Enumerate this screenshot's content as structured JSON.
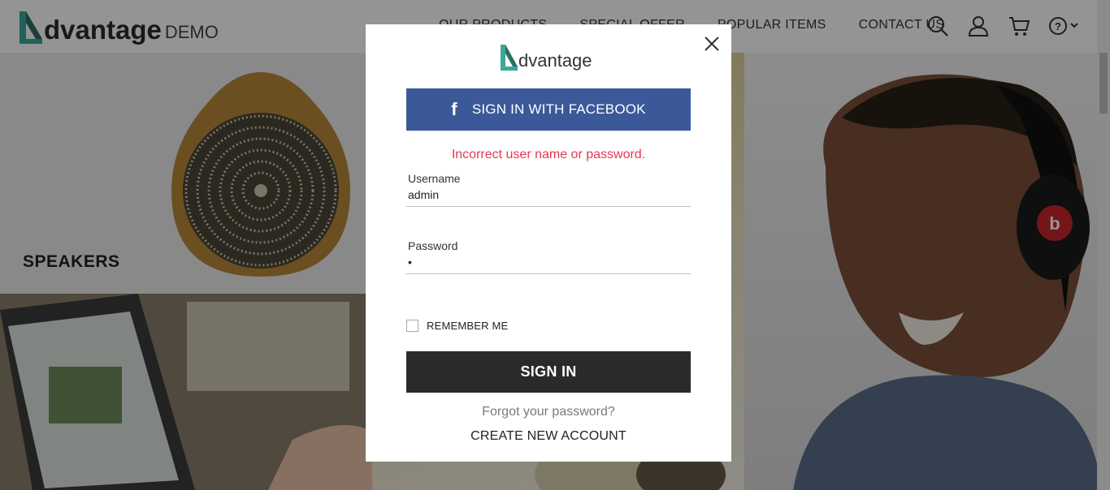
{
  "header": {
    "logo_word": "dvantage",
    "logo_suffix": "DEMO",
    "nav": [
      "OUR PRODUCTS",
      "SPECIAL OFFER",
      "POPULAR ITEMS",
      "CONTACT US"
    ],
    "icons": [
      "search-icon",
      "user-icon",
      "cart-icon",
      "help-icon"
    ]
  },
  "tiles": {
    "speakers_label": "SPEAKERS"
  },
  "modal": {
    "logo_word": "dvantage",
    "facebook_label": "SIGN IN WITH FACEBOOK",
    "facebook_icon": "f",
    "error_message": "Incorrect user name or password.",
    "username_label": "Username",
    "username_value": "admin",
    "password_label": "Password",
    "password_value": "•",
    "remember_label": "REMEMBER ME",
    "signin_label": "SIGN IN",
    "forgot_label": "Forgot your password?",
    "create_label": "CREATE NEW ACCOUNT"
  },
  "colors": {
    "brand_teal": "#3aa89a",
    "facebook_blue": "#3b5998",
    "error_red": "#e5384f",
    "signin_dark": "#2a2a2a"
  }
}
